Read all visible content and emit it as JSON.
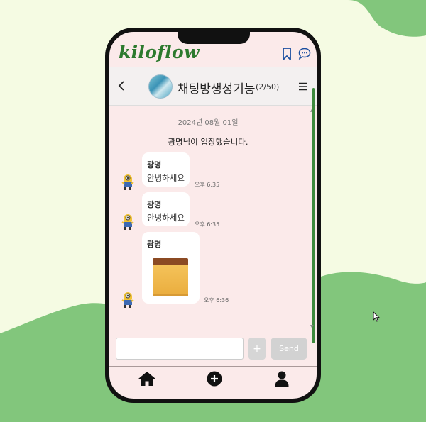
{
  "app": {
    "logo": "kiloflow"
  },
  "header": {
    "icons": [
      "bookmark-icon",
      "chat-bubble-icon"
    ]
  },
  "chat_room": {
    "title": "채팅방생성기능",
    "member_count": "(2/50)",
    "back_icon": "chevron-left-icon",
    "menu_icon": "hamburger-menu-icon"
  },
  "messages": {
    "date": "2024년 08월 01일",
    "system": "광명님이 입장했습니다.",
    "items": [
      {
        "sender": "광명",
        "text": "안녕하세요",
        "time": "오후 6:35"
      },
      {
        "sender": "광명",
        "text": "안녕하세요",
        "time": "오후 6:35"
      },
      {
        "sender": "광명",
        "image": "castella-cake-photo",
        "time": "오후 6:36"
      }
    ]
  },
  "composer": {
    "input_value": "",
    "plus_label": "+",
    "send_label": "Send"
  },
  "bottom_nav": {
    "items": [
      "home-icon",
      "add-circle-icon",
      "profile-icon"
    ]
  },
  "colors": {
    "brand_green": "#2d7a2e",
    "background_blob": "#82c67c",
    "chat_bg": "#fbeaea"
  }
}
